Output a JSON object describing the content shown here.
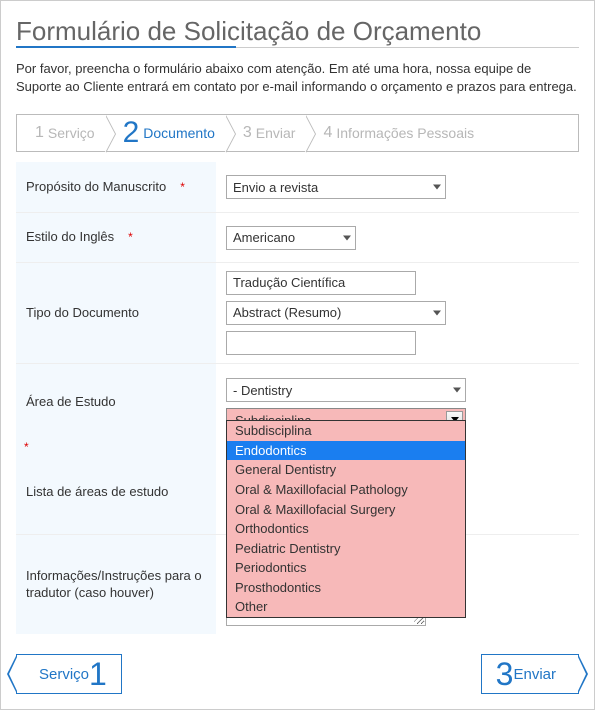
{
  "title": "Formulário de Solicitação de Orçamento",
  "subtitle": "Por favor, preencha o formulário abaixo com atenção. Em até uma hora, nossa equipe de Suporte ao Cliente entrará em contato por e-mail informando o orçamento e prazos para entrega.",
  "steps": [
    {
      "num": "1",
      "label": "Serviço"
    },
    {
      "num": "2",
      "label": "Documento"
    },
    {
      "num": "3",
      "label": "Enviar"
    },
    {
      "num": "4",
      "label": "Informações Pessoais"
    }
  ],
  "active_step_index": 1,
  "fields": {
    "purpose": {
      "label": "Propósito do Manuscrito",
      "required": true,
      "value": "Envio a revista"
    },
    "english_style": {
      "label": "Estilo do Inglês",
      "required": true,
      "value": "Americano"
    },
    "doc_type": {
      "label": "Tipo do Documento",
      "required": false,
      "text_value": "Tradução Científica",
      "select_value": "Abstract (Resumo)",
      "extra_value": ""
    },
    "study_area": {
      "label": "Área de Estudo",
      "required": true,
      "value": "- Dentistry",
      "subdiscipline_selected": "Subdisciplina",
      "subdiscipline_highlight_index": 1,
      "subdiscipline_options": [
        "Subdisciplina",
        "Endodontics",
        "General Dentistry",
        "Oral & Maxillofacial Pathology",
        "Oral & Maxillofacial Surgery",
        "Orthodontics",
        "Pediatric Dentistry",
        "Periodontics",
        "Prosthodontics",
        "Other"
      ]
    },
    "study_area_list": {
      "label": "Lista de áreas de estudo",
      "required": false,
      "value": ""
    },
    "translator_notes": {
      "label": "Informações/Instruções para o tradutor (caso houver)",
      "required": false,
      "value": ""
    }
  },
  "nav": {
    "prev_label": "Serviço",
    "prev_num": "1",
    "next_label": "Enviar",
    "next_num": "3"
  }
}
